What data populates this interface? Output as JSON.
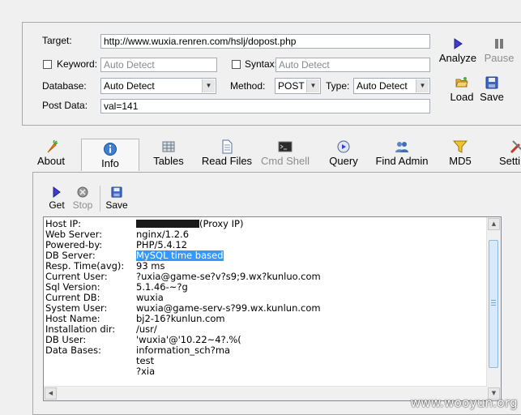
{
  "form": {
    "target_label": "Target:",
    "target_value": "http://www.wuxia.renren.com/hslj/dopost.php",
    "keyword_label": "Keyword:",
    "keyword_placeholder": "Auto Detect",
    "syntax_label": "Syntax:",
    "syntax_placeholder": "Auto Detect",
    "database_label": "Database:",
    "database_value": "Auto Detect",
    "method_label": "Method:",
    "method_value": "POST",
    "type_label": "Type:",
    "type_value": "Auto Detect",
    "postdata_label": "Post Data:",
    "postdata_value": "val=141"
  },
  "actions": {
    "analyze": "Analyze",
    "pause": "Pause",
    "load": "Load",
    "save": "Save"
  },
  "tabs": [
    {
      "label": "About",
      "icon": "carrot-icon"
    },
    {
      "label": "Info",
      "icon": "info-icon"
    },
    {
      "label": "Tables",
      "icon": "table-icon"
    },
    {
      "label": "Read Files",
      "icon": "file-icon"
    },
    {
      "label": "Cmd Shell",
      "icon": "console-icon"
    },
    {
      "label": "Query",
      "icon": "query-icon"
    },
    {
      "label": "Find Admin",
      "icon": "users-icon"
    },
    {
      "label": "MD5",
      "icon": "funnel-icon"
    },
    {
      "label": "Setti",
      "icon": "tools-icon"
    }
  ],
  "subtoolbar": {
    "get": "Get",
    "stop": "Stop",
    "save": "Save"
  },
  "info": {
    "rows": [
      {
        "key": "Host IP:",
        "value": "(Proxy IP)"
      },
      {
        "key": "Web Server:",
        "value": "nginx/1.2.6"
      },
      {
        "key": "Powered-by:",
        "value": "PHP/5.4.12"
      },
      {
        "key": "DB Server:",
        "value": "MySQL time based"
      },
      {
        "key": "Resp. Time(avg):",
        "value": "93 ms"
      },
      {
        "key": "Current User:",
        "value": "?uxia@game-se?v?s9;9.wx?kunluo.com"
      },
      {
        "key": "Sql Version:",
        "value": "5.1.46-~?g"
      },
      {
        "key": "Current DB:",
        "value": "wuxia"
      },
      {
        "key": "System User:",
        "value": "wuxia@game-serv-s?99.wx.kunlun.com"
      },
      {
        "key": "Host Name:",
        "value": "bj2-16?kunlun.com"
      },
      {
        "key": "Installation dir:",
        "value": "/usr/"
      },
      {
        "key": "DB User:",
        "value": "'wuxia'@'10.22~4?.%("
      },
      {
        "key": "Data Bases:",
        "value": "information_sch?ma"
      },
      {
        "key": "",
        "value": "test"
      },
      {
        "key": "",
        "value": "?xia"
      }
    ]
  },
  "watermark": "www.wooyun.org",
  "colors": {
    "selection": "#3399ff",
    "window_bg": "#f0f0f0"
  }
}
